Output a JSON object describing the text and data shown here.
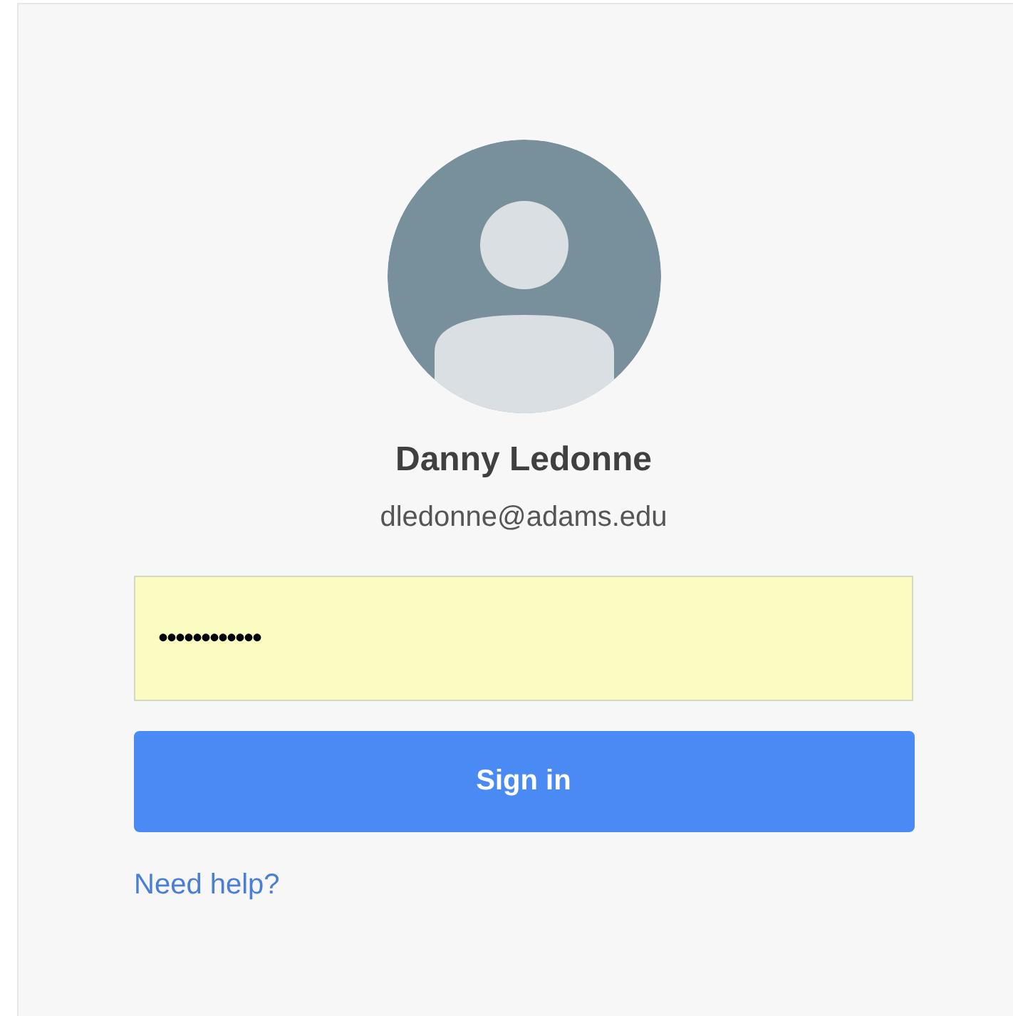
{
  "profile": {
    "name": "Danny Ledonne",
    "email": "dledonne@adams.edu"
  },
  "password_field": {
    "value": "••••••••••••",
    "autofilled": true
  },
  "sign_in_button": {
    "label": "Sign in"
  },
  "help_link": {
    "label": "Need help?"
  }
}
